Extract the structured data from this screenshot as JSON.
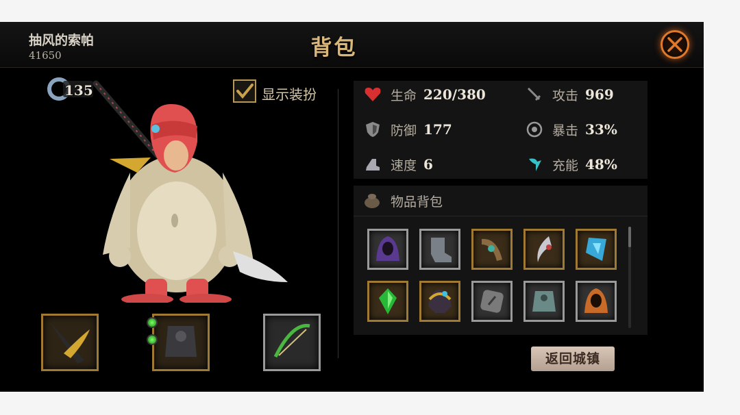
{
  "header": {
    "player_name": "抽风的索帕",
    "player_power": "41650",
    "title": "背包"
  },
  "character": {
    "level": "135",
    "show_costume_label": "显示装扮",
    "show_costume_checked": true
  },
  "stats": [
    {
      "icon": "heart-icon",
      "label": "生命",
      "value": "220/380"
    },
    {
      "icon": "sword-icon",
      "label": "攻击",
      "value": "969"
    },
    {
      "icon": "shield-icon",
      "label": "防御",
      "value": "177"
    },
    {
      "icon": "crit-icon",
      "label": "暴击",
      "value": "33%"
    },
    {
      "icon": "boot-icon",
      "label": "速度",
      "value": "6"
    },
    {
      "icon": "energy-icon",
      "label": "充能",
      "value": "48%"
    }
  ],
  "inventory": {
    "title": "物品背包",
    "items": [
      {
        "name": "purple-hood-item",
        "frame": "silver"
      },
      {
        "name": "iron-boot-item",
        "frame": "silver"
      },
      {
        "name": "scroll-item",
        "frame": "gold"
      },
      {
        "name": "crescent-blade-item",
        "frame": "gold"
      },
      {
        "name": "blue-crystal-item",
        "frame": "gold"
      },
      {
        "name": "green-gem-item",
        "frame": "gold"
      },
      {
        "name": "gold-helmet-item",
        "frame": "gold"
      },
      {
        "name": "stone-rune-item",
        "frame": "silver"
      },
      {
        "name": "steel-armor-item",
        "frame": "silver"
      },
      {
        "name": "orange-hood-item",
        "frame": "silver"
      }
    ]
  },
  "return_button": "返回城镇"
}
